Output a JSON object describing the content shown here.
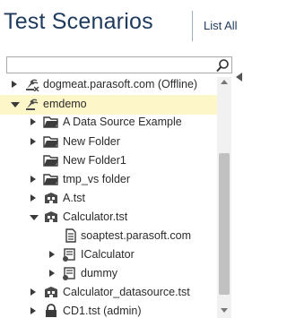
{
  "header": {
    "title": "Test Scenarios",
    "list_all": "List All"
  },
  "search": {
    "value": "",
    "placeholder": ""
  },
  "tree": {
    "dogmeat": "dogmeat.parasoft.com (Offline)",
    "emdemo": "emdemo",
    "data_source": "A Data Source Example",
    "new_folder": "New Folder",
    "new_folder1": "New Folder1",
    "tmp_vs": "tmp_vs folder",
    "a_tst": "A.tst",
    "calculator_tst": "Calculator.tst",
    "soaptest": "soaptest.parasoft.com",
    "icalculator": "ICalculator",
    "dummy": "dummy",
    "calc_datasource": "Calculator_datasource.tst",
    "cd1": "CD1.tst (admin)"
  },
  "colors": {
    "title": "#1e3a5c",
    "selected_row": "#fdf6c8",
    "icon": "#4a4a4a"
  }
}
